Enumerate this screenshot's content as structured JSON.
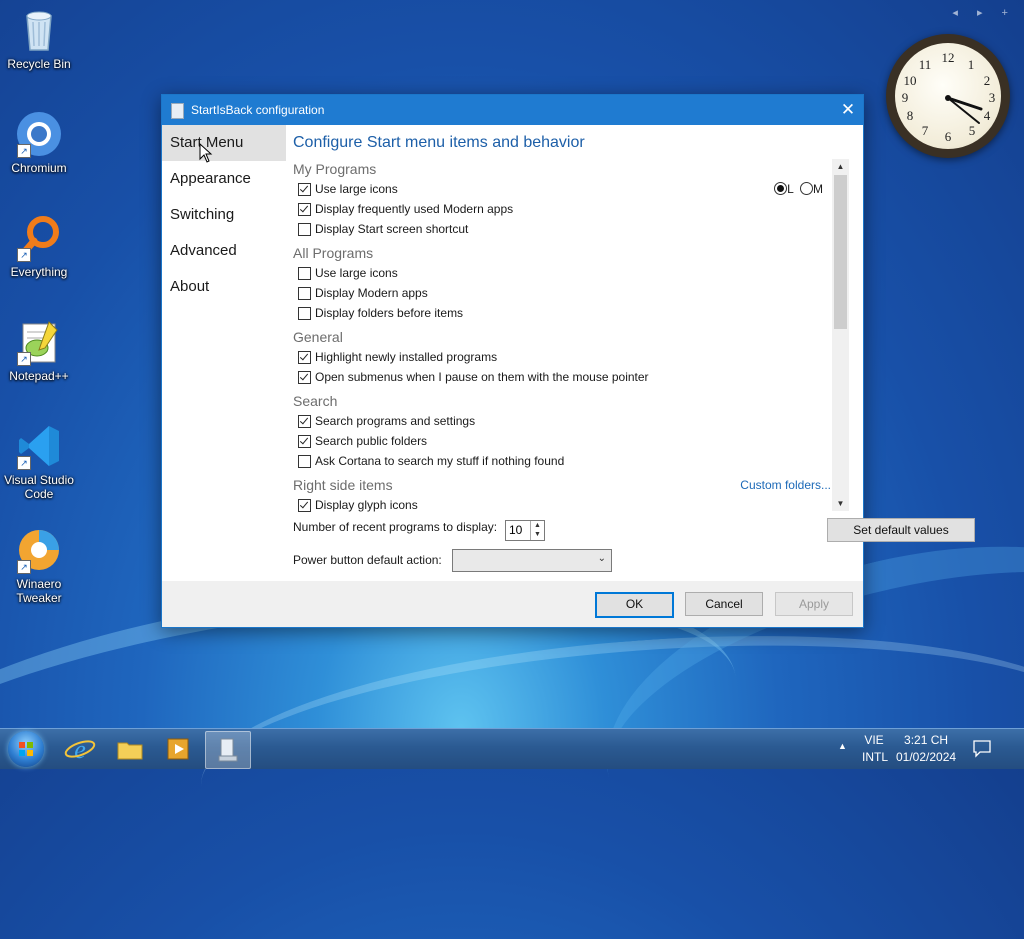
{
  "desktop": {
    "icons": [
      {
        "label": "Recycle Bin",
        "icon": "recycle-bin-icon"
      },
      {
        "label": "Chromium",
        "icon": "chromium-icon"
      },
      {
        "label": "Everything",
        "icon": "everything-icon"
      },
      {
        "label": "Notepad++",
        "icon": "notepadpp-icon"
      },
      {
        "label": "Visual Studio Code",
        "icon": "vscode-icon"
      },
      {
        "label": "Winaero Tweaker",
        "icon": "winaero-tweaker-icon"
      }
    ],
    "gadget_nav": "◂ ▸ +"
  },
  "dialog": {
    "title": "StartIsBack configuration",
    "close_glyph": "✕",
    "sidebar": [
      "Start Menu",
      "Appearance",
      "Switching",
      "Advanced",
      "About"
    ],
    "active_tab": "Start Menu",
    "heading": "Configure Start menu items and behavior",
    "sections": {
      "my_programs": "My Programs",
      "all_programs": "All Programs",
      "general": "General",
      "search": "Search",
      "right_side": "Right side items"
    },
    "options": {
      "mp_large_icons": {
        "label": "Use large icons",
        "checked": true
      },
      "mp_modern_apps": {
        "label": "Display frequently used Modern apps",
        "checked": true
      },
      "mp_start_screen": {
        "label": "Display Start screen shortcut",
        "checked": false
      },
      "ap_large_icons": {
        "label": "Use large icons",
        "checked": false
      },
      "ap_modern_apps": {
        "label": "Display Modern apps",
        "checked": false
      },
      "ap_folders_before": {
        "label": "Display folders before items",
        "checked": false
      },
      "gen_highlight": {
        "label": "Highlight newly installed programs",
        "checked": true
      },
      "gen_submenus": {
        "label": "Open submenus when I pause on them with the mouse pointer",
        "checked": true
      },
      "search_programs": {
        "label": "Search programs and settings",
        "checked": true
      },
      "search_public": {
        "label": "Search public folders",
        "checked": true
      },
      "search_cortana": {
        "label": "Ask Cortana to search my stuff if nothing found",
        "checked": false
      },
      "rs_glyph": {
        "label": "Display glyph icons",
        "checked": true
      }
    },
    "icon_size_radio": {
      "l_label": "L",
      "m_label": "M",
      "selected": "L"
    },
    "custom_folders_link": "Custom folders...",
    "recent_label": "Number of recent programs to display:",
    "recent_value": "10",
    "set_default_label": "Set default values",
    "power_label": "Power button default action:",
    "power_value": "",
    "ok_label": "OK",
    "cancel_label": "Cancel",
    "apply_label": "Apply"
  },
  "taskbar": {
    "pinned": [
      "internet-explorer-icon",
      "file-explorer-icon",
      "media-player-icon",
      "startisback-config-icon"
    ],
    "tray_arrow": "▲",
    "lang_top": "VIE",
    "lang_bottom": "INTL",
    "time": "3:21 CH",
    "date": "01/02/2024"
  },
  "colors": {
    "accent": "#1f7bd1",
    "heading": "#1d5fa8",
    "link": "#1d6ab8"
  }
}
